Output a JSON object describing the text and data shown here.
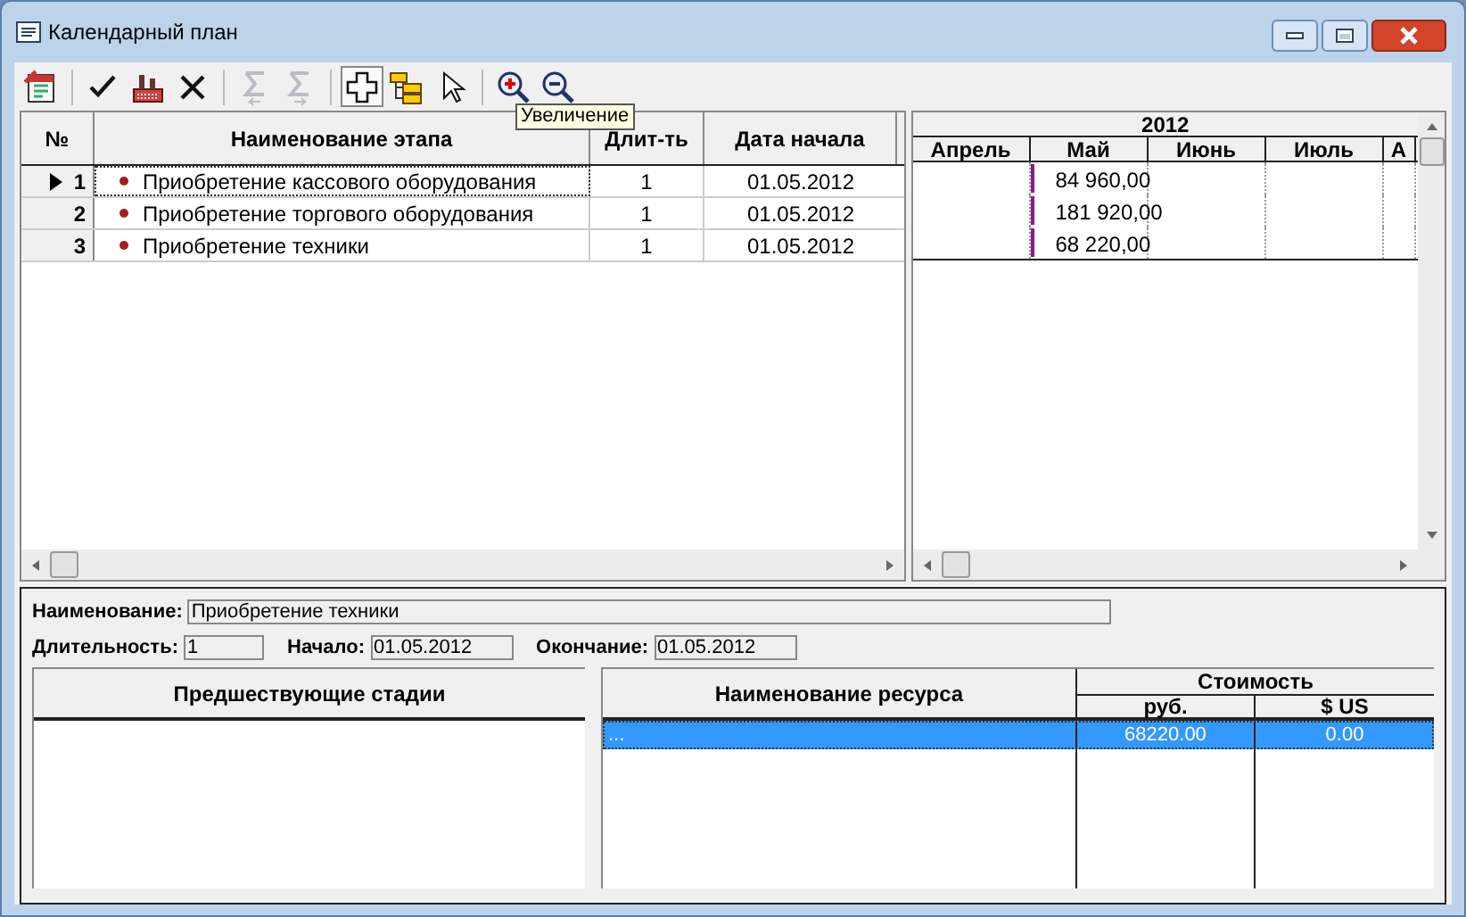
{
  "window": {
    "title": "Календарный план"
  },
  "toolbar": {
    "items": [
      {
        "kind": "calendar",
        "disabled": false,
        "pressed": false
      },
      {
        "kind": "separator"
      },
      {
        "kind": "check",
        "disabled": false,
        "pressed": false
      },
      {
        "kind": "factory",
        "disabled": false,
        "pressed": false
      },
      {
        "kind": "cross",
        "disabled": false,
        "pressed": false
      },
      {
        "kind": "separator"
      },
      {
        "kind": "sigma-left",
        "disabled": true,
        "pressed": false
      },
      {
        "kind": "sigma-right",
        "disabled": true,
        "pressed": false
      },
      {
        "kind": "separator"
      },
      {
        "kind": "plus",
        "disabled": false,
        "pressed": true
      },
      {
        "kind": "tree",
        "disabled": false,
        "pressed": false
      },
      {
        "kind": "pointer",
        "disabled": false,
        "pressed": false
      },
      {
        "kind": "separator"
      },
      {
        "kind": "zoom-in",
        "disabled": false,
        "pressed": false
      },
      {
        "kind": "zoom-out",
        "disabled": false,
        "pressed": false
      }
    ],
    "tooltip": "Увеличение"
  },
  "stages": {
    "columns": [
      "№",
      "Наименование этапа",
      "Длит-ть",
      "Дата начала"
    ],
    "rows": [
      {
        "number": "1",
        "name": "Приобретение кассового оборудования",
        "duration": "1",
        "start": "01.05.2012",
        "selected": true
      },
      {
        "number": "2",
        "name": "Приобретение торгового оборудования",
        "duration": "1",
        "start": "01.05.2012",
        "selected": false
      },
      {
        "number": "3",
        "name": "Приобретение техники",
        "duration": "1",
        "start": "01.05.2012",
        "selected": false
      }
    ]
  },
  "gantt": {
    "year": "2012",
    "months": [
      "Апрель",
      "Май",
      "Июнь",
      "Июль",
      "А"
    ],
    "bars": [
      {
        "value": "84 960,00"
      },
      {
        "value": "181 920,00"
      },
      {
        "value": "68 220,00"
      }
    ]
  },
  "details": {
    "name_label": "Наименование:",
    "name_value": "Приобретение техники",
    "duration_label": "Длительность:",
    "duration_value": "1",
    "start_label": "Начало:",
    "start_value": "01.05.2012",
    "end_label": "Окончание:",
    "end_value": "01.05.2012"
  },
  "predecessors": {
    "header": "Предшествующие стадии"
  },
  "resources": {
    "name_column": "Наименование ресурса",
    "cost_group": "Стоимость",
    "cost_columns": [
      "руб.",
      "$ US"
    ],
    "rows": [
      {
        "name": "...",
        "rub": "68220.00",
        "usd": "0.00",
        "selected": true
      }
    ]
  }
}
